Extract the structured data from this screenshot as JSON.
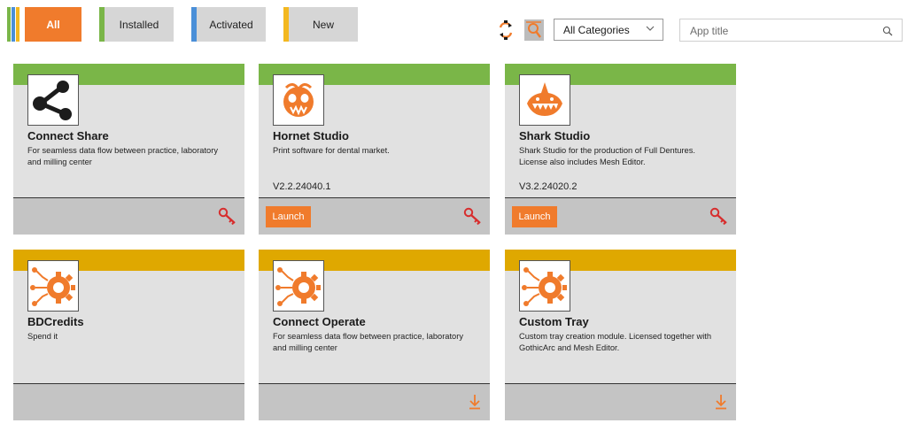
{
  "filters": {
    "all": "All",
    "installed": "Installed",
    "activated": "Activated",
    "new": "New"
  },
  "toolbar": {
    "category_selected": "All Categories",
    "search_placeholder": "App title"
  },
  "colors": {
    "accent": "#f07b2c",
    "installed_band": "#7ab648",
    "new_band": "#dfa800",
    "strip_green": "#7ab648",
    "strip_blue": "#4a8fd8",
    "strip_yellow": "#f3b820"
  },
  "cards": [
    {
      "title": "Connect Share",
      "description": "For seamless data flow between practice, laboratory and milling center",
      "version": "",
      "icon": "share-icon",
      "status": "installed",
      "action": "license-key"
    },
    {
      "title": "Hornet Studio",
      "description": "Print software for dental market.",
      "version": "V2.2.24040.1",
      "icon": "hornet-icon",
      "status": "installed",
      "launch": "Launch",
      "action": "license-key"
    },
    {
      "title": "Shark Studio",
      "description": "Shark Studio for the production of Full Dentures. License also includes Mesh Editor.",
      "version": "V3.2.24020.2",
      "icon": "shark-icon",
      "status": "installed",
      "launch": "Launch",
      "action": "license-key"
    },
    {
      "title": "BDCredits",
      "description": "Spend it",
      "version": "",
      "icon": "gear-circuit-icon",
      "status": "new",
      "action": "none"
    },
    {
      "title": "Connect Operate",
      "description": "For seamless data flow between practice, laboratory and milling center",
      "version": "",
      "icon": "gear-circuit-icon",
      "status": "new",
      "action": "download"
    },
    {
      "title": "Custom Tray",
      "description": "Custom tray creation module. Licensed together with GothicArc and Mesh Editor.",
      "version": "",
      "icon": "gear-circuit-icon",
      "status": "new",
      "action": "download"
    }
  ]
}
